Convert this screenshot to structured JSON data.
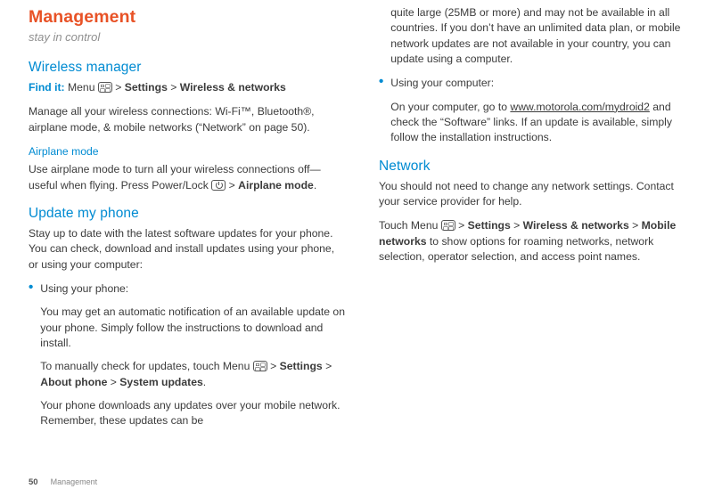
{
  "left": {
    "title": "Management",
    "tagline": "stay in control",
    "sec1": {
      "h": "Wireless manager",
      "findit_label": "Find it:",
      "findit_pre": " Menu ",
      "findit_sep1": " > ",
      "findit_b1": "Settings",
      "findit_sep2": " > ",
      "findit_b2": "Wireless & networks",
      "p1": "Manage all your wireless connections: Wi-Fi™, Bluetooth®, airplane mode, & mobile networks (“Network” on page 50).",
      "sub_h": "Airplane mode",
      "sub_p_a": "Use airplane mode to turn all your wireless connections off—useful when flying. Press Power/Lock ",
      "sub_p_b": " > ",
      "sub_p_bold": "Airplane mode",
      "sub_p_c": "."
    },
    "sec2": {
      "h": "Update my phone",
      "p1": "Stay up to date with the latest software updates for your phone. You can check, download and install updates using your phone, or using your computer:",
      "b1": {
        "lead": "Using your phone:",
        "p1": "You may get an automatic notification of an available update on your phone. Simply follow the instructions to download and install.",
        "p2a": "To manually check for updates, touch Menu ",
        "p2b": " > ",
        "p2b1": "Settings",
        "p2c": " > ",
        "p2b2": "About phone",
        "p2d": " > ",
        "p2b3": "System updates",
        "p2e": ".",
        "p3": "Your phone downloads any updates over your mobile network. Remember, these updates can be"
      }
    }
  },
  "right": {
    "cont": "quite large (25MB or more) and may not be available in all countries. If you don’t have an unlimited data plan, or mobile network updates are not available in your country, you can update using a computer.",
    "b2": {
      "lead": "Using your computer:",
      "p1a": "On your computer, go to ",
      "p1link": "www.motorola.com/mydroid2",
      "p1b": " and check the “Software” links. If an update is available, simply follow the installation instructions."
    },
    "net": {
      "h": "Network",
      "p1": "You should not need to change any network settings. Contact your service provider for help.",
      "p2a": "Touch Menu ",
      "p2b": " > ",
      "p2b1": "Settings",
      "p2c": " > ",
      "p2b2": "Wireless & networks",
      "p2d": " > ",
      "p2b3": "Mobile networks",
      "p2e": " to show options for roaming networks, network selection, operator selection, and access point names."
    }
  },
  "footer": {
    "page": "50",
    "section": "Management"
  }
}
